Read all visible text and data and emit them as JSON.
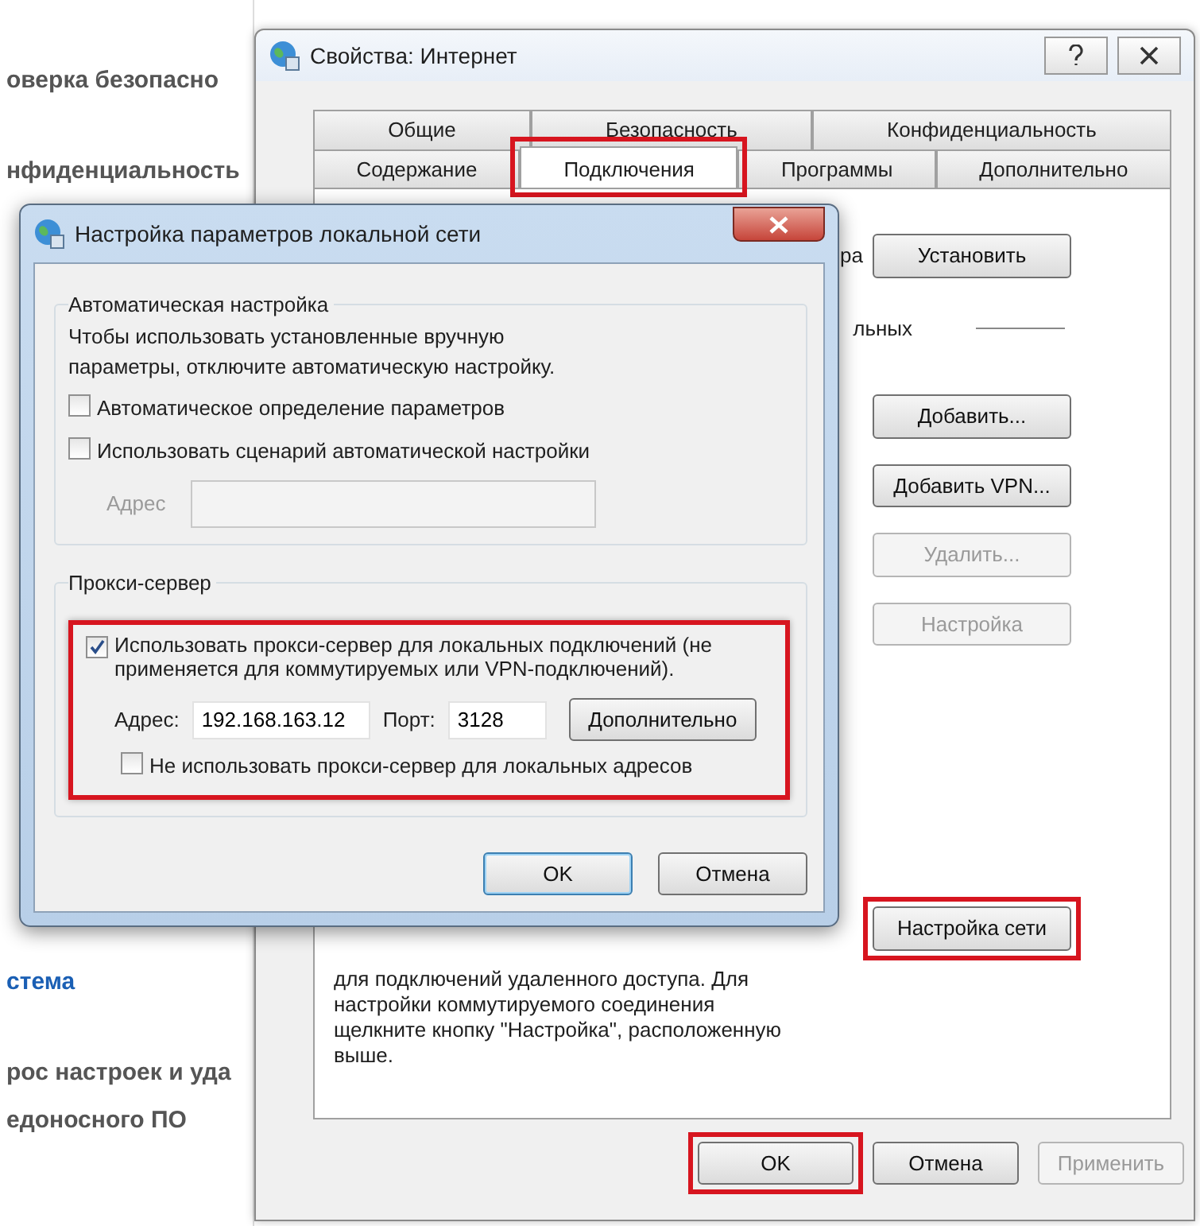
{
  "background_page": {
    "items": [
      {
        "text": "оверка безопасно",
        "link": false
      },
      {
        "text": "нфиденциальность",
        "link": false
      },
      {
        "text": "стема",
        "link": true
      },
      {
        "text": "рос настроек и уда",
        "link": false
      },
      {
        "text": "едоносного ПО",
        "link": false
      }
    ]
  },
  "internet_properties": {
    "title": "Свойства: Интернет",
    "tab_rows": [
      [
        {
          "label": "Общие",
          "selected": false,
          "highlighted": false
        },
        {
          "label": "Безопасность",
          "selected": false,
          "highlighted": false
        },
        {
          "label": "Конфиденциальность",
          "selected": false,
          "highlighted": false
        }
      ],
      [
        {
          "label": "Содержание",
          "selected": false,
          "highlighted": false
        },
        {
          "label": "Подключения",
          "selected": true,
          "highlighted": true
        },
        {
          "label": "Программы",
          "selected": false,
          "highlighted": false
        },
        {
          "label": "Дополнительно",
          "selected": false,
          "highlighted": false
        }
      ]
    ],
    "setup_text_fragment": "ра",
    "install_button": "Установить",
    "lan_text_fragment": "льных",
    "connection_buttons": [
      {
        "label": "Добавить...",
        "disabled": false
      },
      {
        "label": "Добавить VPN...",
        "disabled": false
      },
      {
        "label": "Удалить...",
        "disabled": true
      },
      {
        "label": "Настройка",
        "disabled": true
      }
    ],
    "lan_button": {
      "label": "Настройка сети",
      "highlighted": true
    },
    "note": "для подключений удаленного доступа. Для настройки коммутируемого соединения щелкните кнопку \"Настройка\", расположенную выше.",
    "footer_buttons": [
      {
        "label": "OK",
        "disabled": false,
        "highlighted": true
      },
      {
        "label": "Отмена",
        "disabled": false,
        "highlighted": false
      },
      {
        "label": "Применить",
        "disabled": true,
        "highlighted": false
      }
    ]
  },
  "lan_dialog": {
    "title": "Настройка параметров локальной сети",
    "auto": {
      "legend": "Автоматическая настройка",
      "description": "Чтобы использовать установленные вручную параметры, отключите автоматическую настройку.",
      "options": [
        {
          "label": "Автоматическое определение параметров",
          "checked": false
        },
        {
          "label": "Использовать сценарий автоматической настройки",
          "checked": false
        }
      ],
      "address_label": "Адрес",
      "address_disabled": true
    },
    "proxy": {
      "legend": "Прокси-сервер",
      "highlighted": true,
      "use_proxy": {
        "label": "Использовать прокси-сервер для локальных подключений (не применяется для коммутируемых или VPN-подключений).",
        "checked": true
      },
      "address_label": "Адрес:",
      "address_value": "192.168.163.12",
      "port_label": "Порт:",
      "port_value": "3128",
      "advanced_button": "Дополнительно",
      "bypass_local": {
        "label": "Не использовать прокси-сервер для локальных адресов",
        "checked": false
      }
    },
    "buttons": [
      {
        "label": "OK",
        "default": true
      },
      {
        "label": "Отмена",
        "default": false
      }
    ]
  }
}
